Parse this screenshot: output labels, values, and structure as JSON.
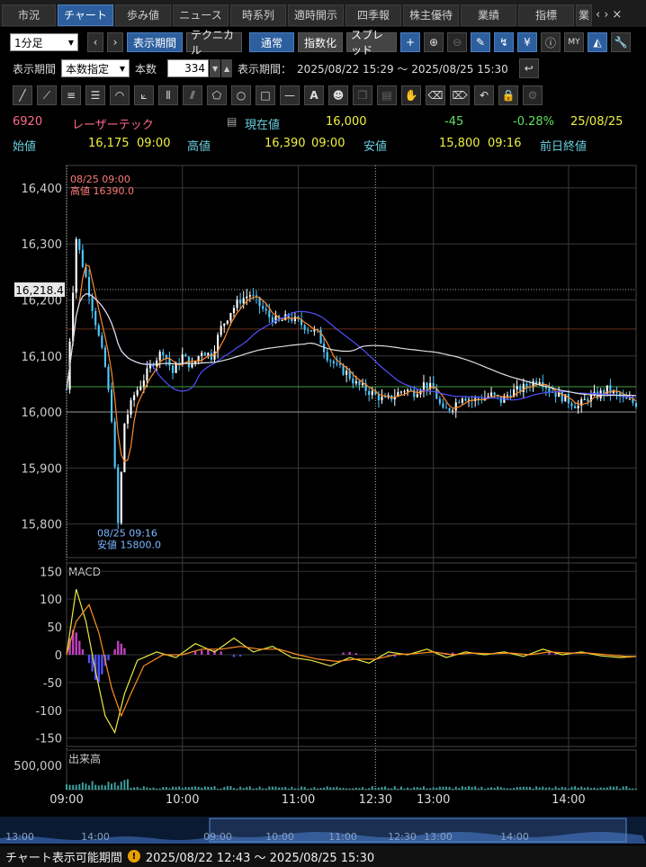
{
  "tabs": [
    "市況",
    "チャート",
    "歩み値",
    "ニュース",
    "時系列",
    "適時開示",
    "四季報",
    "株主優待",
    "業績",
    "指標",
    "業"
  ],
  "active_tab": 1,
  "toolbar": {
    "interval": "1分足",
    "period_button": "表示期間",
    "technical_button": "テクニカル",
    "normal_button": "通常",
    "index_button": "指数化",
    "spread_button": "スプレッド"
  },
  "period_row": {
    "label": "表示期間",
    "mode": "本数指定",
    "count_label": "本数",
    "count": "334",
    "range_label": "表示期間：",
    "range": "2025/08/22 15:29 ～ 2025/08/25 15:30"
  },
  "stock": {
    "code": "6920",
    "name": "レーザーテック",
    "current_label": "現在値",
    "current": "16,000",
    "change": "-45",
    "change_pct": "-0.28%",
    "date": "25/08/25",
    "open_label": "始値",
    "open": "16,175",
    "open_time": "09:00",
    "high_label": "高値",
    "high": "16,390",
    "high_time": "09:00",
    "low_label": "安値",
    "low": "15,800",
    "low_time": "09:16",
    "prev_close_label": "前日終値"
  },
  "chart_data": [
    {
      "type": "candlestick",
      "ylim": [
        15740,
        16440
      ],
      "yticks": [
        15800,
        15900,
        16000,
        16100,
        16200,
        16300,
        16400
      ],
      "ytick_labels": [
        "15,800",
        "15,900",
        "16,000",
        "16,100",
        "16,200",
        "16,300",
        "16,400"
      ],
      "xticks": [
        "09:00",
        "10:00",
        "11:00",
        "12:30",
        "13:00",
        "14:00"
      ],
      "cursor_value": "16,218.4",
      "annotations": [
        {
          "text": "08/25 09:00",
          "color": "#ff7a7a"
        },
        {
          "text": "高値 16390.0",
          "color": "#ff7a7a"
        },
        {
          "text": "08/25 09:16",
          "color": "#7ab8ff"
        },
        {
          "text": "安値 15800.0",
          "color": "#7ab8ff"
        }
      ],
      "price_path": [
        [
          0,
          16040
        ],
        [
          3,
          16310
        ],
        [
          6,
          16240
        ],
        [
          9,
          16160
        ],
        [
          12,
          16080
        ],
        [
          14,
          15990
        ],
        [
          16,
          15800
        ],
        [
          18,
          15980
        ],
        [
          21,
          16030
        ],
        [
          24,
          16060
        ],
        [
          27,
          16090
        ],
        [
          30,
          16110
        ],
        [
          33,
          16070
        ],
        [
          36,
          16100
        ],
        [
          39,
          16080
        ],
        [
          42,
          16110
        ],
        [
          45,
          16100
        ],
        [
          48,
          16150
        ],
        [
          51,
          16180
        ],
        [
          54,
          16200
        ],
        [
          57,
          16210
        ],
        [
          60,
          16190
        ],
        [
          63,
          16170
        ],
        [
          66,
          16160
        ],
        [
          69,
          16170
        ],
        [
          72,
          16160
        ],
        [
          75,
          16150
        ],
        [
          78,
          16140
        ],
        [
          81,
          16100
        ],
        [
          84,
          16080
        ],
        [
          87,
          16070
        ],
        [
          90,
          16050
        ],
        [
          93,
          16040
        ],
        [
          96,
          16030
        ],
        [
          99,
          16020
        ],
        [
          102,
          16030
        ],
        [
          105,
          16040
        ],
        [
          108,
          16035
        ],
        [
          111,
          16050
        ],
        [
          114,
          16040
        ],
        [
          117,
          16000
        ],
        [
          120,
          16010
        ],
        [
          123,
          16030
        ],
        [
          126,
          16020
        ],
        [
          129,
          16025
        ],
        [
          132,
          16030
        ],
        [
          135,
          16020
        ],
        [
          138,
          16035
        ],
        [
          141,
          16040
        ],
        [
          144,
          16050
        ],
        [
          147,
          16060
        ],
        [
          150,
          16040
        ],
        [
          153,
          16030
        ],
        [
          156,
          16020
        ],
        [
          159,
          16010
        ],
        [
          162,
          16025
        ],
        [
          165,
          16030
        ],
        [
          168,
          16040
        ],
        [
          171,
          16030
        ],
        [
          174,
          16020
        ],
        [
          177,
          16015
        ]
      ]
    },
    {
      "type": "line",
      "title": "MACD",
      "ylim": [
        -165,
        165
      ],
      "yticks": [
        -150,
        -100,
        -50,
        0,
        50,
        100,
        150
      ],
      "series": [
        {
          "color": "#e8e840",
          "values": [
            [
              0,
              0
            ],
            [
              3,
              118
            ],
            [
              6,
              60
            ],
            [
              9,
              -30
            ],
            [
              12,
              -110
            ],
            [
              15,
              -140
            ],
            [
              18,
              -70
            ],
            [
              22,
              -10
            ],
            [
              28,
              5
            ],
            [
              34,
              -5
            ],
            [
              40,
              20
            ],
            [
              46,
              5
            ],
            [
              52,
              30
            ],
            [
              58,
              5
            ],
            [
              64,
              15
            ],
            [
              70,
              -5
            ],
            [
              76,
              -10
            ],
            [
              82,
              -20
            ],
            [
              88,
              -5
            ],
            [
              94,
              -15
            ],
            [
              100,
              5
            ],
            [
              106,
              0
            ],
            [
              112,
              10
            ],
            [
              118,
              -5
            ],
            [
              124,
              5
            ],
            [
              130,
              0
            ],
            [
              136,
              5
            ],
            [
              142,
              -3
            ],
            [
              148,
              10
            ],
            [
              154,
              0
            ],
            [
              160,
              5
            ],
            [
              166,
              -2
            ],
            [
              172,
              -5
            ],
            [
              177,
              -3
            ]
          ]
        },
        {
          "color": "#ff9020",
          "values": [
            [
              0,
              0
            ],
            [
              3,
              60
            ],
            [
              7,
              90
            ],
            [
              10,
              40
            ],
            [
              14,
              -60
            ],
            [
              17,
              -110
            ],
            [
              20,
              -70
            ],
            [
              24,
              -20
            ],
            [
              30,
              0
            ],
            [
              36,
              0
            ],
            [
              42,
              10
            ],
            [
              48,
              10
            ],
            [
              54,
              15
            ],
            [
              60,
              10
            ],
            [
              66,
              10
            ],
            [
              72,
              0
            ],
            [
              78,
              -8
            ],
            [
              84,
              -12
            ],
            [
              90,
              -8
            ],
            [
              96,
              -8
            ],
            [
              102,
              0
            ],
            [
              108,
              2
            ],
            [
              114,
              5
            ],
            [
              120,
              0
            ],
            [
              126,
              3
            ],
            [
              132,
              2
            ],
            [
              138,
              3
            ],
            [
              144,
              0
            ],
            [
              150,
              5
            ],
            [
              156,
              3
            ],
            [
              162,
              3
            ],
            [
              168,
              0
            ],
            [
              174,
              -3
            ],
            [
              177,
              -3
            ]
          ]
        }
      ],
      "histogram": [
        [
          1,
          30
        ],
        [
          2,
          45
        ],
        [
          3,
          40
        ],
        [
          4,
          25
        ],
        [
          5,
          10
        ],
        [
          7,
          -15
        ],
        [
          8,
          -30
        ],
        [
          9,
          -45
        ],
        [
          10,
          -50
        ],
        [
          11,
          -35
        ],
        [
          12,
          -20
        ],
        [
          13,
          -10
        ],
        [
          15,
          10
        ],
        [
          16,
          25
        ],
        [
          17,
          20
        ],
        [
          18,
          12
        ],
        [
          40,
          6
        ],
        [
          42,
          8
        ],
        [
          44,
          10
        ],
        [
          46,
          8
        ],
        [
          48,
          6
        ],
        [
          52,
          -4
        ],
        [
          54,
          -3
        ],
        [
          86,
          4
        ],
        [
          88,
          5
        ],
        [
          90,
          3
        ],
        [
          100,
          -3
        ],
        [
          102,
          -4
        ],
        [
          118,
          3
        ],
        [
          120,
          4
        ],
        [
          150,
          4
        ],
        [
          152,
          3
        ]
      ]
    },
    {
      "type": "bar",
      "title": "出来高",
      "ytick_labels": [
        "500,000"
      ]
    }
  ],
  "overview": {
    "labels": [
      "13:00",
      "14:00",
      "09:00",
      "10:00",
      "11:00",
      "12:30",
      "13:00",
      "14:00"
    ]
  },
  "status": {
    "label": "チャート表示可能期間",
    "range": "2025/08/22 12:43 ～ 2025/08/25 15:30"
  }
}
